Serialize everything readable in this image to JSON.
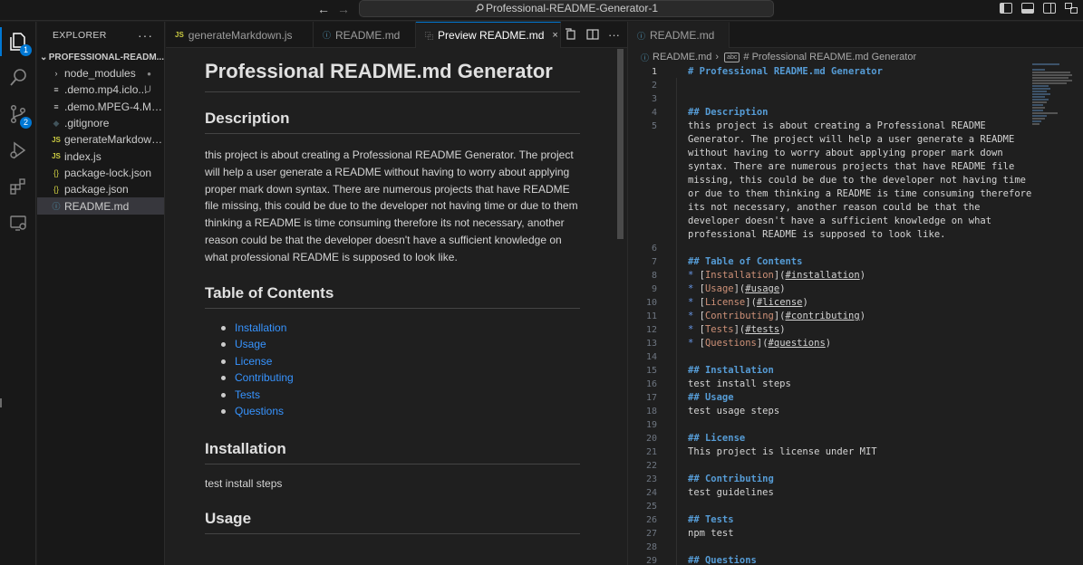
{
  "window": {
    "search_text": "Professional-README-Generator-1",
    "nav_back": "←",
    "nav_forward": "→"
  },
  "activity_bar": {
    "explorer_badge": "1",
    "source_control_badge": "2"
  },
  "sidebar": {
    "title": "EXPLORER",
    "more": "···",
    "folder_name": "PROFESSIONAL-READM...",
    "items": [
      {
        "label": "node_modules",
        "icon": "›",
        "status": "●",
        "type": "folder"
      },
      {
        "label": ".demo.mp4.iclo...",
        "icon": "≡",
        "status": "U",
        "type": "file"
      },
      {
        "label": ".demo.MPEG-4.MP4...",
        "icon": "≡",
        "status": "",
        "type": "file"
      },
      {
        "label": ".gitignore",
        "icon": "◆",
        "status": "",
        "type": "git"
      },
      {
        "label": "generateMarkdown.js",
        "icon": "JS",
        "status": "",
        "type": "js"
      },
      {
        "label": "index.js",
        "icon": "JS",
        "status": "",
        "type": "js"
      },
      {
        "label": "package-lock.json",
        "icon": "{}",
        "status": "",
        "type": "json"
      },
      {
        "label": "package.json",
        "icon": "{}",
        "status": "",
        "type": "json"
      },
      {
        "label": "README.md",
        "icon": "ⓘ",
        "status": "",
        "type": "md"
      }
    ]
  },
  "group1": {
    "tabs": [
      {
        "label": "generateMarkdown.js",
        "icon": "JS"
      },
      {
        "label": "README.md",
        "icon": "ⓘ"
      },
      {
        "label": "Preview README.md",
        "icon": "⿻"
      }
    ],
    "close_glyph": "×"
  },
  "preview": {
    "h1": "Professional README.md Generator",
    "description_heading": "Description",
    "description_text": "this project is about creating a Professional README Generator. The project will help a user generate a README without having to worry about applying proper mark down syntax. There are numerous projects that have README file missing, this could be due to the developer not having time or due to them thinking a README is time consuming therefore its not necessary, another reason could be that the developer doesn't have a sufficient knowledge on what professional README is supposed to look like.",
    "toc_heading": "Table of Contents",
    "toc_items": [
      "Installation",
      "Usage",
      "License",
      "Contributing",
      "Tests",
      "Questions"
    ],
    "installation_heading": "Installation",
    "installation_text": "test install steps",
    "usage_heading": "Usage"
  },
  "group2": {
    "tab_label": "README.md",
    "tab_icon": "ⓘ",
    "breadcrumb_file": "README.md",
    "breadcrumb_sep": "›",
    "breadcrumb_symbol": "# Professional README.md Generator"
  },
  "code": {
    "line1": "# Professional README.md Generator",
    "desc_heading": "## Description",
    "desc_lines": [
      "this project is about creating a Professional README",
      "Generator. The project will help a user generate a README",
      "without having to worry about applying proper mark down",
      "syntax. There are numerous projects that have README file",
      "missing, this could be due to the developer not having time",
      "or due to them thinking a README is time consuming therefore",
      "its not necessary, another reason could be that the",
      "developer doesn't have a sufficient knowledge on what",
      "professional README is supposed to look like."
    ],
    "toc_heading": "## Table of Contents",
    "toc_links": [
      {
        "text": "Installation",
        "url": "#installation"
      },
      {
        "text": "Usage",
        "url": "#usage"
      },
      {
        "text": "License",
        "url": "#license"
      },
      {
        "text": "Contributing",
        "url": "#contributing"
      },
      {
        "text": "Tests",
        "url": "#tests"
      },
      {
        "text": "Questions",
        "url": "#questions"
      }
    ],
    "install_heading": "## Installation",
    "install_text": "test install steps",
    "usage_heading": "## Usage",
    "usage_text": "test usage steps",
    "license_heading": "## License",
    "license_text": "This project is license under MIT",
    "contrib_heading": "## Contributing",
    "contrib_text": "test guidelines",
    "tests_heading": "## Tests",
    "tests_text": "npm test",
    "questions_heading": "## Questions",
    "line_numbers": [
      "1",
      "2",
      "3",
      "4",
      "5",
      "6",
      "7",
      "8",
      "9",
      "10",
      "11",
      "12",
      "13",
      "14",
      "15",
      "16",
      "17",
      "18",
      "19",
      "20",
      "21",
      "22",
      "23",
      "24",
      "25",
      "26",
      "27",
      "28",
      "29"
    ]
  }
}
